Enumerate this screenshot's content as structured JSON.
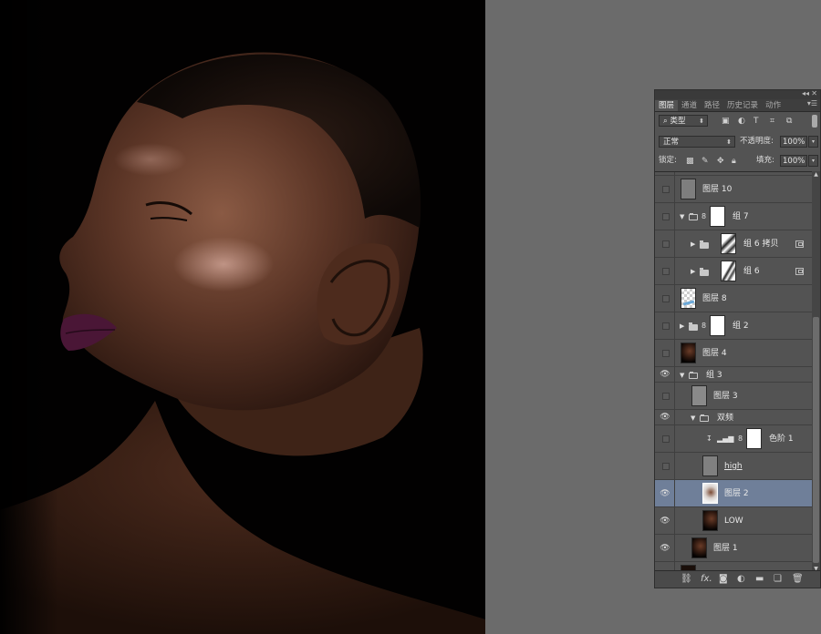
{
  "panel": {
    "tabs": [
      "图层",
      "通道",
      "路径",
      "历史记录",
      "动作"
    ],
    "active_tab": 0,
    "filter": {
      "label": "类型"
    },
    "blend_mode": "正常",
    "opacity_label": "不透明度:",
    "opacity_value": "100%",
    "lock_label": "锁定:",
    "fill_label": "填充:",
    "fill_value": "100%"
  },
  "layers": [
    {
      "name": "图层 10",
      "visible": false,
      "indent": 0,
      "type": "layer",
      "thumb": "#7e7e7e"
    },
    {
      "name": "组 7",
      "visible": false,
      "indent": 0,
      "type": "group",
      "expanded": true,
      "mask": "white",
      "chain": true
    },
    {
      "name": "组 6 拷贝",
      "visible": false,
      "indent": 1,
      "type": "group",
      "expanded": false,
      "mask": "photo",
      "smart": true
    },
    {
      "name": "组 6",
      "visible": false,
      "indent": 1,
      "type": "group",
      "expanded": false,
      "mask": "photo",
      "smart": true
    },
    {
      "name": "图层 8",
      "visible": false,
      "indent": 0,
      "type": "layer",
      "thumb": "checker"
    },
    {
      "name": "组 2",
      "visible": false,
      "indent": 0,
      "type": "group",
      "expanded": false,
      "mask": "white",
      "chain": true
    },
    {
      "name": "图层 4",
      "visible": false,
      "indent": 0,
      "type": "layer",
      "thumb": "portrait"
    },
    {
      "name": "组 3",
      "visible": true,
      "indent": 0,
      "type": "group-header",
      "expanded": true
    },
    {
      "name": "图层 3",
      "visible": false,
      "indent": 1,
      "type": "layer",
      "thumb": "#8a8a8a"
    },
    {
      "name": "双频",
      "visible": true,
      "indent": 1,
      "type": "group-header",
      "expanded": true
    },
    {
      "name": "色阶 1",
      "visible": false,
      "indent": 2,
      "type": "adjustment",
      "mask": "white",
      "clipped": true
    },
    {
      "name": "high",
      "visible": false,
      "indent": 2,
      "type": "layer",
      "thumb": "#808080",
      "underline": true
    },
    {
      "name": "图层 2",
      "visible": true,
      "indent": 2,
      "type": "layer",
      "thumb": "portrait-light",
      "selected": true
    },
    {
      "name": "LOW",
      "visible": true,
      "indent": 2,
      "type": "layer",
      "thumb": "portrait"
    },
    {
      "name": "图层 1",
      "visible": true,
      "indent": 1,
      "type": "layer",
      "thumb": "portrait"
    }
  ],
  "icons": {
    "visible": "eye-icon",
    "link": "link-icon",
    "fx": "fx-icon",
    "mask": "mask-icon",
    "adjustment": "adjustment-icon",
    "folder": "folder-icon",
    "new_layer": "new-layer-icon",
    "trash": "trash-icon"
  },
  "bottom_bar": {
    "fx_label": "fx."
  }
}
